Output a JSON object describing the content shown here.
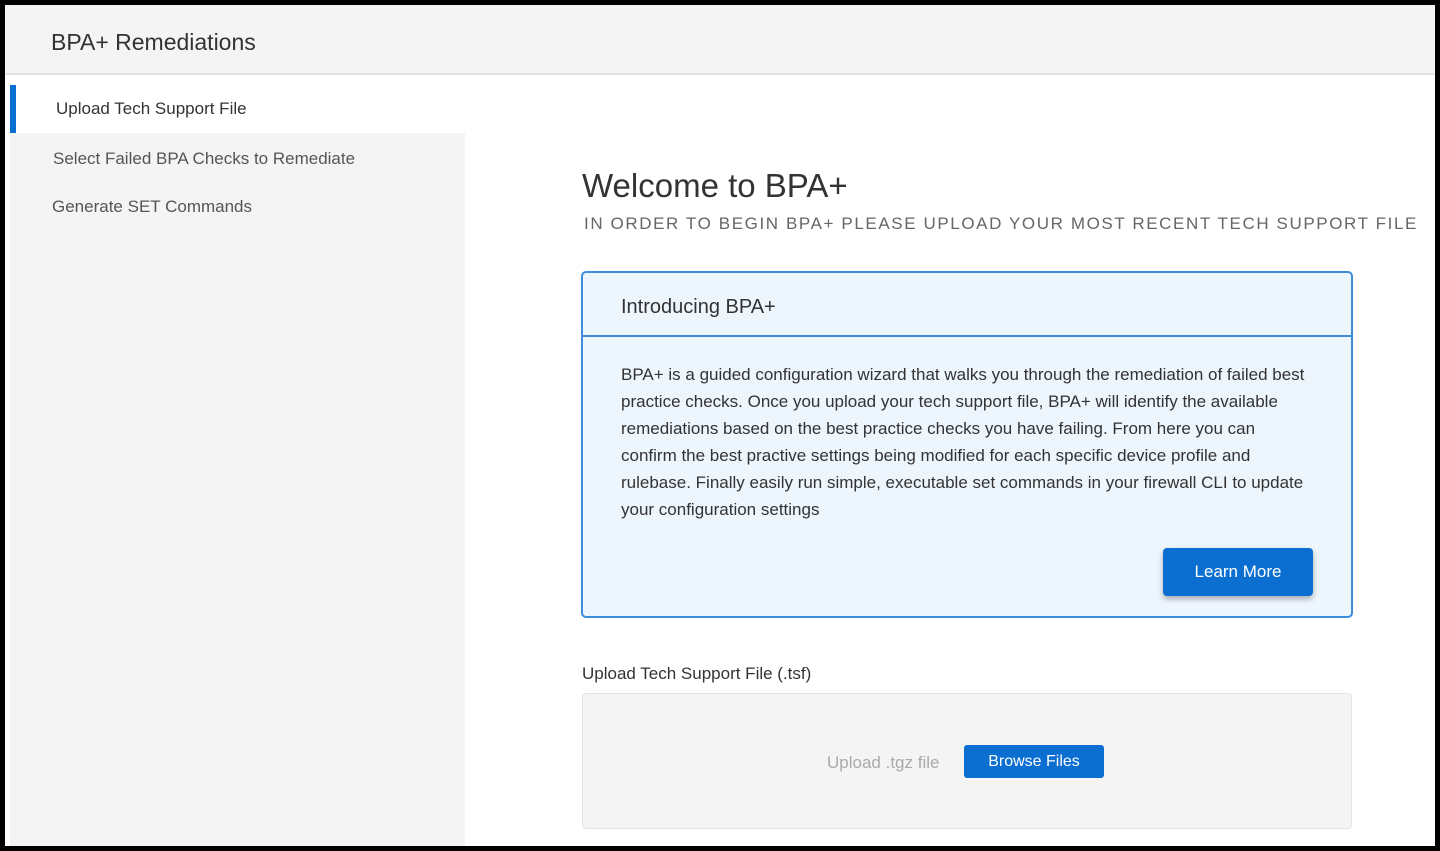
{
  "app": {
    "title": "BPA+ Remediations"
  },
  "sidebar": {
    "items": [
      {
        "label": "Upload Tech Support File",
        "active": true
      },
      {
        "label": "Select Failed BPA Checks to Remediate",
        "active": false
      },
      {
        "label": "Generate SET Commands",
        "active": false
      }
    ]
  },
  "main": {
    "title": "Welcome to BPA+",
    "subtitle": "IN ORDER TO BEGIN BPA+ PLEASE UPLOAD YOUR MOST RECENT TECH SUPPORT FILE",
    "intro": {
      "title": "Introducing BPA+",
      "body": "BPA+ is a guided configuration wizard that walks you through the remediation of failed best practice checks. Once you upload your tech support file, BPA+ will identify the available remediations based on the best practice checks you have failing. From here you can confirm the best practive settings being modified for each specific device profile and rulebase. Finally easily run simple, executable set commands in your firewall CLI to update your configuration settings",
      "learn_more_label": "Learn More"
    },
    "upload": {
      "label": "Upload Tech Support File (.tsf)",
      "placeholder": "Upload .tgz file",
      "browse_label": "Browse Files"
    }
  },
  "colors": {
    "accent": "#0b6fd1",
    "card_border": "#3e8ddb",
    "card_bg": "#edf5fd",
    "sidebar_bg": "#f4f4f4"
  }
}
